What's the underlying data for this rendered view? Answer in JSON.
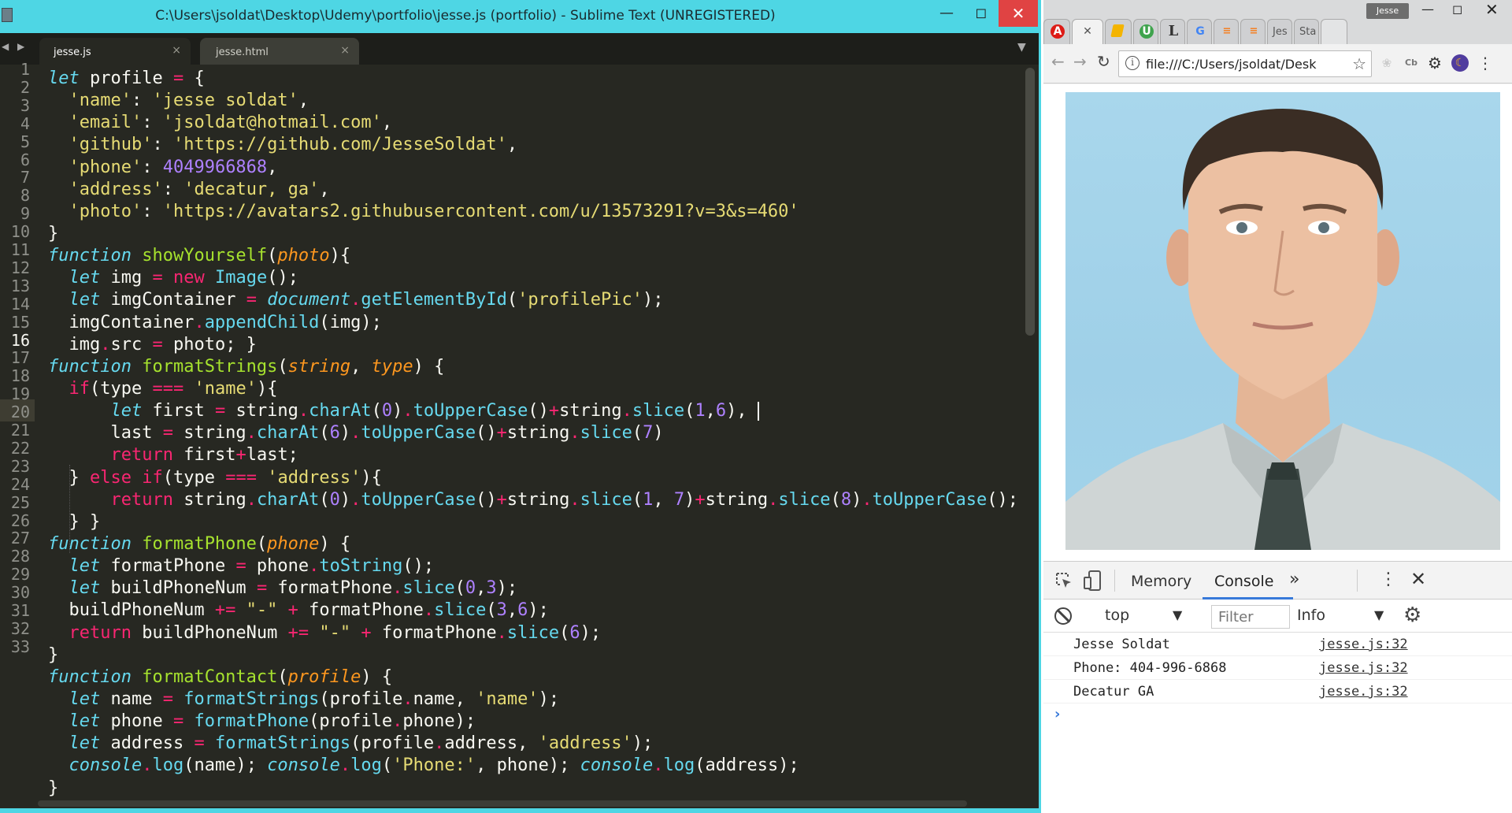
{
  "sublime": {
    "title": "C:\\Users\\jsoldat\\Desktop\\Udemy\\portfolio\\jesse.js (portfolio) - Sublime Text (UNREGISTERED)",
    "tabs": [
      {
        "label": "jesse.js",
        "active": true
      },
      {
        "label": "jesse.html",
        "active": false
      }
    ],
    "active_line": 16,
    "line_numbers": [
      "1",
      "2",
      "3",
      "4",
      "5",
      "6",
      "7",
      "8",
      "9",
      "10",
      "11",
      "12",
      "13",
      "14",
      "15",
      "16",
      "17",
      "18",
      "19",
      "20",
      "21",
      "22",
      "23",
      "24",
      "25",
      "26",
      "27",
      "28",
      "29",
      "30",
      "31",
      "32",
      "33"
    ],
    "code_lines": [
      "let profile = {",
      "  'name': 'jesse soldat',",
      "  'email': 'jsoldat@hotmail.com',",
      "  'github': 'https://github.com/JesseSoldat',",
      "  'phone': 4049966868,",
      "  'address': 'decatur, ga',",
      "  'photo': 'https://avatars2.githubusercontent.com/u/13573291?v=3&s=460'",
      "}",
      "function showYourself(photo){",
      "  let img = new Image();",
      "  let imgContainer = document.getElementById('profilePic');",
      "  imgContainer.appendChild(img);",
      "  img.src = photo; }",
      "function formatStrings(string, type) {",
      "  if(type === 'name'){",
      "      let first = string.charAt(0).toUpperCase()+string.slice(1,6),",
      "      last = string.charAt(6).toUpperCase()+string.slice(7)",
      "      return first+last;",
      "  } else if(type === 'address'){",
      "      return string.charAt(0).toUpperCase()+string.slice(1, 7)+string.slice(8).toUpperCase();",
      "  } }",
      "function formatPhone(phone) {",
      "  let formatPhone = phone.toString();",
      "  let buildPhoneNum = formatPhone.slice(0,3);",
      "  buildPhoneNum += \"-\" + formatPhone.slice(3,6);",
      "  return buildPhoneNum += \"-\" + formatPhone.slice(6);",
      "}",
      "function formatContact(profile) {",
      "  let name = formatStrings(profile.name, 'name');",
      "  let phone = formatPhone(profile.phone);",
      "  let address = formatStrings(profile.address, 'address');",
      "  console.log(name); console.log('Phone:', phone); console.log(address);",
      "}"
    ]
  },
  "chrome": {
    "profile_name": "Jesse",
    "tabs": [
      {
        "icon": "A",
        "color": "#dd1b16"
      },
      {
        "icon": "✕",
        "color": "#555555"
      },
      {
        "icon": "",
        "color": "#f4b400"
      },
      {
        "icon": "U",
        "color": "#3fa34d"
      },
      {
        "icon": "L",
        "color": "#333333"
      },
      {
        "icon": "G",
        "color": "#4285f4"
      },
      {
        "icon": "",
        "color": "#f48024"
      },
      {
        "icon": "",
        "color": "#f48024"
      },
      {
        "icon": "Jes",
        "color": "#777777"
      },
      {
        "icon": "Sta",
        "color": "#777777"
      }
    ],
    "url": "file:///C:/Users/jsoldat/Desk",
    "devtools": {
      "tabs": {
        "memory": "Memory",
        "console": "Console"
      },
      "more_tabs": "»",
      "context": "top",
      "filter_placeholder": "Filter",
      "level": "Info",
      "messages": [
        {
          "text": "Jesse Soldat",
          "source": "jesse.js:32"
        },
        {
          "text": "Phone: 404-996-6868",
          "source": "jesse.js:32"
        },
        {
          "text": "Decatur GA",
          "source": "jesse.js:32"
        }
      ],
      "prompt": "›"
    }
  },
  "colors": {
    "title_bar": "#4ed6e4",
    "editor_bg": "#272822",
    "keyword": "#f92672",
    "function": "#a6e22e",
    "string": "#e6db74",
    "number": "#ae81ff",
    "storage": "#66d9ef",
    "param": "#fd971f"
  }
}
